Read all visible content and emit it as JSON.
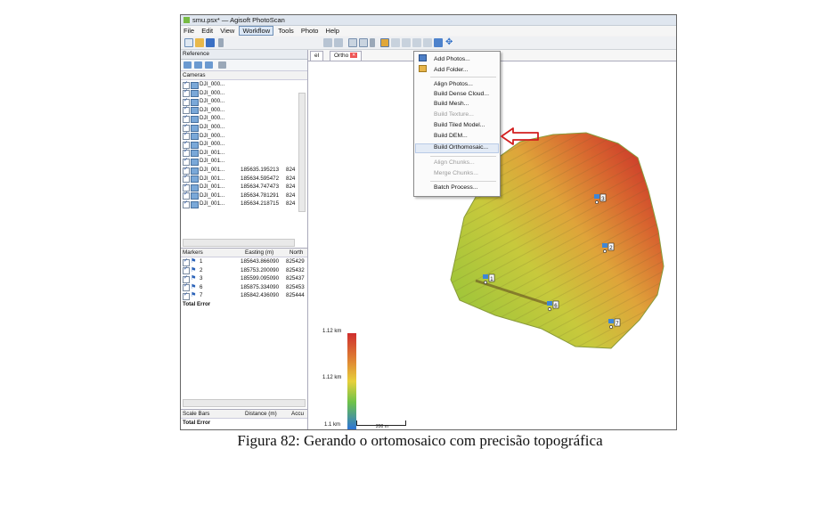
{
  "window": {
    "title": "smu.psx* — Agisoft PhotoScan"
  },
  "menubar": [
    "File",
    "Edit",
    "View",
    "Workflow",
    "Tools",
    "Photo",
    "Help"
  ],
  "workflow_menu": [
    {
      "label": "Add Photos...",
      "enabled": true
    },
    {
      "label": "Add Folder...",
      "enabled": true
    },
    {
      "label": "Align Photos...",
      "enabled": true
    },
    {
      "label": "Build Dense Cloud...",
      "enabled": true
    },
    {
      "label": "Build Mesh...",
      "enabled": true
    },
    {
      "label": "Build Texture...",
      "enabled": false
    },
    {
      "label": "Build Tiled Model...",
      "enabled": true
    },
    {
      "label": "Build DEM...",
      "enabled": true
    },
    {
      "label": "Build Orthomosaic...",
      "enabled": true
    },
    {
      "label": "Align Chunks...",
      "enabled": false
    },
    {
      "label": "Merge Chunks...",
      "enabled": false
    },
    {
      "label": "Batch Process...",
      "enabled": true
    }
  ],
  "reference_panel": {
    "title": "Reference",
    "cameras_header": "Cameras",
    "cameras": [
      {
        "label": "DJI_000...",
        "easting": ""
      },
      {
        "label": "DJI_000...",
        "easting": ""
      },
      {
        "label": "DJI_000...",
        "easting": ""
      },
      {
        "label": "DJI_000...",
        "easting": ""
      },
      {
        "label": "DJI_000...",
        "easting": ""
      },
      {
        "label": "DJI_000...",
        "easting": ""
      },
      {
        "label": "DJI_000...",
        "easting": ""
      },
      {
        "label": "DJI_000...",
        "easting": ""
      },
      {
        "label": "DJI_001...",
        "easting": ""
      },
      {
        "label": "DJI_001...",
        "easting": ""
      },
      {
        "label": "DJI_001...",
        "easting": "185635.195213",
        "north": "824"
      },
      {
        "label": "DJI_001...",
        "easting": "185634.595472",
        "north": "824"
      },
      {
        "label": "DJI_001...",
        "easting": "185634.747473",
        "north": "824"
      },
      {
        "label": "DJI_001...",
        "easting": "185634.781291",
        "north": "824"
      },
      {
        "label": "DJI_001...",
        "easting": "185634.218715",
        "north": "824"
      }
    ],
    "markers_header": "Markers",
    "markers_col_easting": "Easting (m)",
    "markers_col_north": "North",
    "markers": [
      {
        "label": "1",
        "easting": "185643.866090",
        "north": "825429"
      },
      {
        "label": "2",
        "easting": "185753.200090",
        "north": "825432"
      },
      {
        "label": "3",
        "easting": "185599.095090",
        "north": "825437"
      },
      {
        "label": "6",
        "easting": "185875.334090",
        "north": "825453"
      },
      {
        "label": "7",
        "easting": "185842.436090",
        "north": "825444"
      }
    ],
    "total_error": "Total Error",
    "scalebars_header": "Scale Bars",
    "scalebars_col_distance": "Distance (m)",
    "scalebars_col_accuracy": "Accu",
    "scalebars_total_error": "Total Error"
  },
  "view_tabs": [
    {
      "label": "el"
    },
    {
      "label": "Ortho"
    }
  ],
  "legend": {
    "top": "1.12 km",
    "mid": "1.12 km",
    "bottom": "1.1 km"
  },
  "scale_label": "200 m",
  "map_markers": [
    "1",
    "2",
    "3",
    "6",
    "7"
  ],
  "caption": "Figura 82: Gerando o ortomosaico com precisão topográfica",
  "colors": {
    "accent": "#d21f1f",
    "dem_low": "#2a7bd8",
    "dem_mid": "#e3c43a",
    "dem_high": "#d63b2c"
  }
}
